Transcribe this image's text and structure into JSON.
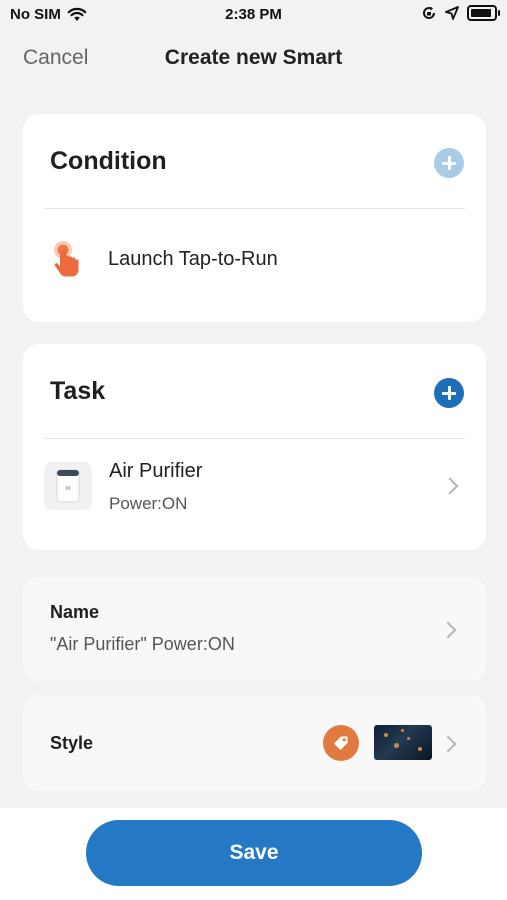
{
  "status_bar": {
    "carrier": "No SIM",
    "time": "2:38 PM",
    "icons": [
      "wifi-icon",
      "orientation-lock-icon",
      "location-arrow-icon",
      "battery-icon"
    ]
  },
  "nav": {
    "cancel_label": "Cancel",
    "title": "Create new Smart"
  },
  "condition": {
    "heading": "Condition",
    "add_icon": "plus-icon",
    "item": {
      "icon": "tap-hand-icon",
      "label": "Launch Tap-to-Run"
    }
  },
  "task": {
    "heading": "Task",
    "add_icon": "plus-icon",
    "item": {
      "icon": "air-purifier-icon",
      "name": "Air Purifier",
      "detail": "Power:ON"
    }
  },
  "name_section": {
    "title": "Name",
    "value": "\"Air Purifier\" Power:ON"
  },
  "style_section": {
    "title": "Style",
    "icon": "tag-icon",
    "cover": "cover-image-thumbnail"
  },
  "save_label": "Save",
  "colors": {
    "primary": "#2578c4",
    "add_disabled": "#a9cbe6",
    "add_active": "#1f6fb8",
    "tag_orange": "#e07a3f",
    "background": "#f2f2f2"
  }
}
